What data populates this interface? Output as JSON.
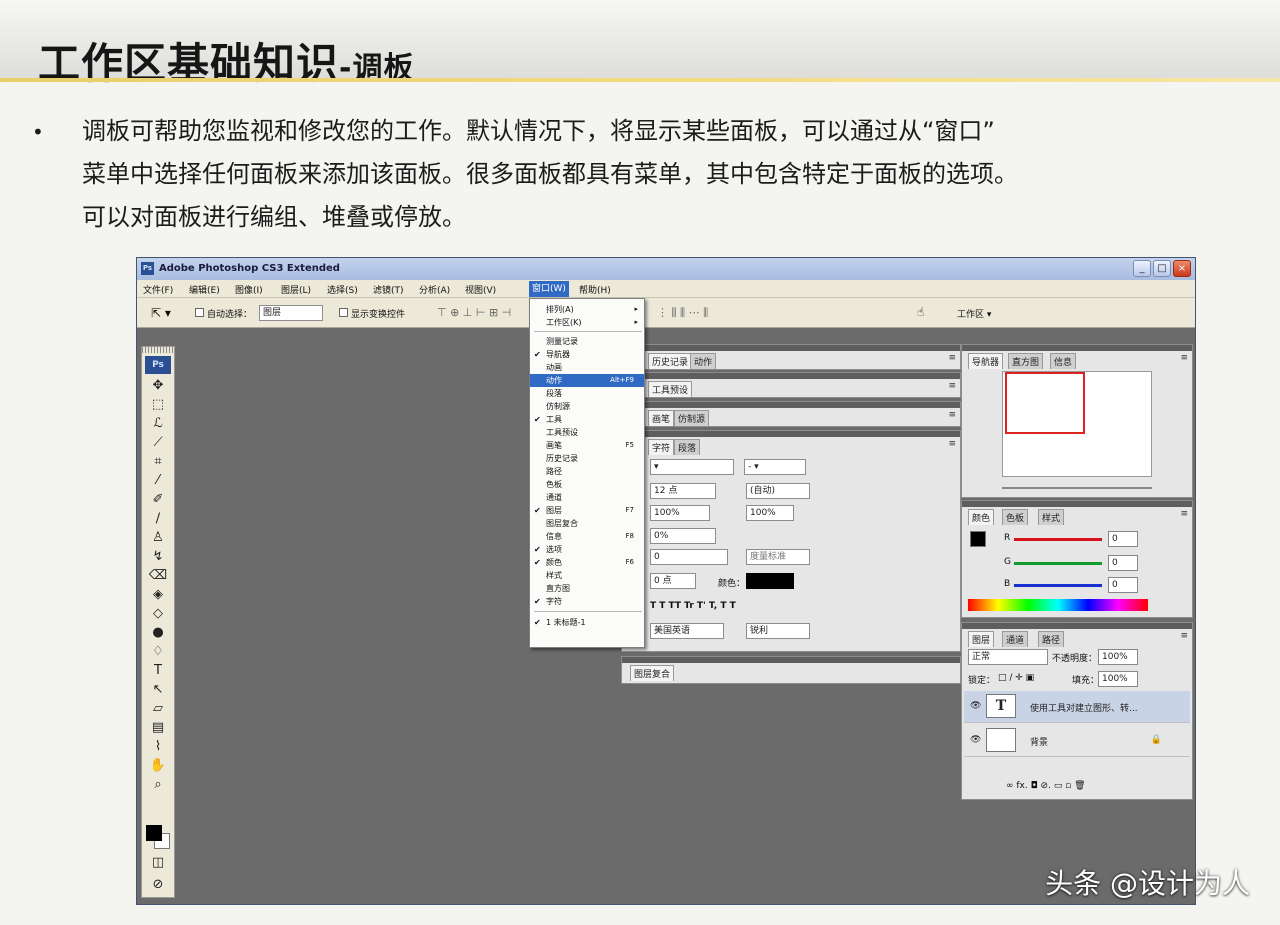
{
  "slide": {
    "title_main": "工作区基础知识",
    "title_sub": "-调板",
    "bullet": "•",
    "paragraph_lines": [
      "调板可帮助您监视和修改您的工作。默认情况下，将显示某些面板，可以通过从“窗口”",
      "菜单中选择任何面板来添加该面板。很多面板都具有菜单，其中包含特定于面板的选项。",
      "可以对面板进行编组、堆叠或停放。"
    ]
  },
  "photoshop": {
    "window_title": "Adobe Photoshop CS3 Extended",
    "logo": "Ps",
    "menus": [
      "文件(F)",
      "编辑(E)",
      "图像(I)",
      "图层(L)",
      "选择(S)",
      "滤镜(T)",
      "分析(A)",
      "视图(V)",
      "窗口(W)",
      "帮助(H)"
    ],
    "active_menu": "窗口(W)",
    "options_bar": {
      "auto_select_label": "自动选择：",
      "auto_select_value": "图层",
      "show_transform_label": "显示变换控件",
      "workspace_label": "工作区 ▾"
    },
    "window_menu": {
      "items": [
        {
          "label": "排列(A)",
          "check": "",
          "shortcut": "",
          "submenu": true
        },
        {
          "label": "工作区(K)",
          "check": "",
          "shortcut": "",
          "submenu": true
        },
        {
          "label": "测量记录",
          "check": "",
          "shortcut": ""
        },
        {
          "label": "导航器",
          "check": "✔",
          "shortcut": ""
        },
        {
          "label": "动画",
          "check": "",
          "shortcut": ""
        },
        {
          "label": "动作",
          "check": "",
          "shortcut": "Alt+F9",
          "highlight": true
        },
        {
          "label": "段落",
          "check": "",
          "shortcut": ""
        },
        {
          "label": "仿制源",
          "check": "",
          "shortcut": ""
        },
        {
          "label": "工具",
          "check": "✔",
          "shortcut": ""
        },
        {
          "label": "工具预设",
          "check": "",
          "shortcut": ""
        },
        {
          "label": "画笔",
          "check": "",
          "shortcut": "F5"
        },
        {
          "label": "历史记录",
          "check": "",
          "shortcut": ""
        },
        {
          "label": "路径",
          "check": "",
          "shortcut": ""
        },
        {
          "label": "色板",
          "check": "",
          "shortcut": ""
        },
        {
          "label": "通道",
          "check": "",
          "shortcut": ""
        },
        {
          "label": "图层",
          "check": "✔",
          "shortcut": "F7"
        },
        {
          "label": "图层复合",
          "check": "",
          "shortcut": ""
        },
        {
          "label": "信息",
          "check": "",
          "shortcut": "F8"
        },
        {
          "label": "选项",
          "check": "✔",
          "shortcut": ""
        },
        {
          "label": "颜色",
          "check": "✔",
          "shortcut": "F6"
        },
        {
          "label": "样式",
          "check": "",
          "shortcut": ""
        },
        {
          "label": "直方图",
          "check": "",
          "shortcut": ""
        },
        {
          "label": "字符",
          "check": "✔",
          "shortcut": ""
        }
      ],
      "doc_item": {
        "label": "1 未标题-1",
        "check": "✔"
      }
    },
    "center_panels": {
      "p1_tabs": [
        "历史记录",
        "动作"
      ],
      "p2_tabs": [
        "工具预设"
      ],
      "p3_tabs": [
        "画笔",
        "仿制源"
      ],
      "p4_tabs": [
        "字符",
        "段落"
      ],
      "char_font_size": "12 点",
      "char_leading": "(自动)",
      "char_vscale": "100%",
      "char_hscale": "100%",
      "char_tracking": "0%",
      "char_kerning": "0",
      "char_kerning_label": "度量标准",
      "char_baseline": "0 点",
      "char_color_label": "颜色：",
      "char_styles": "T  T  TT  Tr  T'  T,  T  T",
      "char_lang": "美国英语",
      "char_aa": "锐利",
      "p5_tabs": [
        "图层复合"
      ]
    },
    "right_panels": {
      "nav_tabs": [
        "导航器",
        "直方图",
        "信息"
      ],
      "color_tabs": [
        "颜色",
        "色板",
        "样式"
      ],
      "color_channels": [
        {
          "label": "R",
          "value": "0",
          "color": "#d8121b"
        },
        {
          "label": "G",
          "value": "0",
          "color": "#129b2f"
        },
        {
          "label": "B",
          "value": "0",
          "color": "#1a2fcf"
        }
      ],
      "layer_tabs": [
        "图层",
        "通道",
        "路径"
      ],
      "blend_mode": "正常",
      "opacity_label": "不透明度：",
      "opacity_value": "100%",
      "lock_label": "锁定：",
      "fill_label": "填充：",
      "fill_value": "100%",
      "layers": [
        {
          "thumb": "T",
          "name": "使用工具对建立图形、转..."
        },
        {
          "thumb": "",
          "name": "背景"
        }
      ],
      "bottom_icons": "∞  fx.  ◘  ⊘.  ▭  ▫  🗑"
    }
  },
  "watermark": "头条 @设计为人"
}
